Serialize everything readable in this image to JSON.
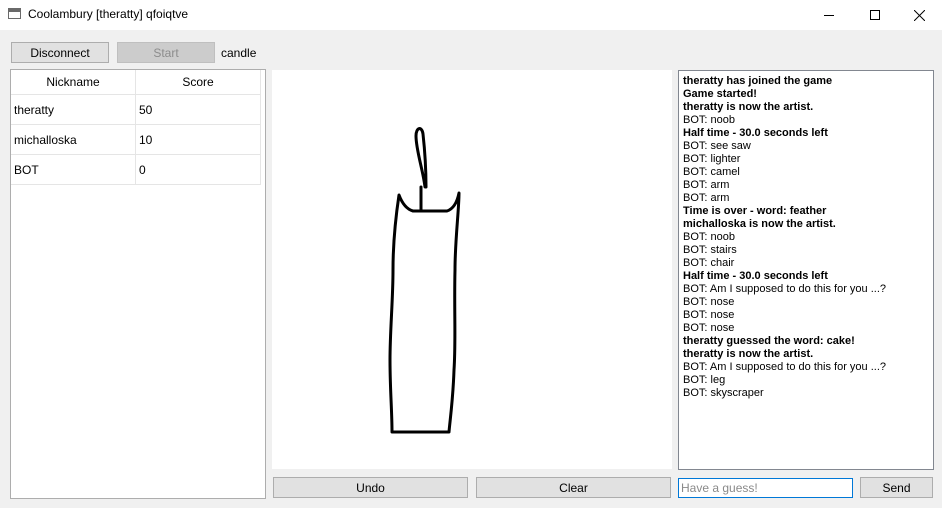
{
  "window": {
    "title": "Coolambury [theratty] qfoiqtve",
    "controls": {
      "minimize": "minimize-icon",
      "maximize": "maximize-icon",
      "close": "close-icon"
    }
  },
  "toolbar": {
    "disconnect_label": "Disconnect",
    "start_label": "Start",
    "word": "candle"
  },
  "players": {
    "headers": [
      "Nickname",
      "Score"
    ],
    "rows": [
      {
        "nickname": "theratty",
        "score": "50"
      },
      {
        "nickname": "michalloska",
        "score": "10"
      },
      {
        "nickname": "BOT",
        "score": "0"
      }
    ]
  },
  "canvas": {
    "drawing": "candle sketch",
    "stroke_color": "#000000"
  },
  "chat": {
    "messages": [
      {
        "text": "theratty has joined the game",
        "bold": true
      },
      {
        "text": "Game started!",
        "bold": true
      },
      {
        "text": "theratty is now the artist.",
        "bold": true
      },
      {
        "text": "BOT: noob",
        "bold": false
      },
      {
        "text": "Half time - 30.0 seconds left",
        "bold": true
      },
      {
        "text": "BOT: see saw",
        "bold": false
      },
      {
        "text": "BOT: lighter",
        "bold": false
      },
      {
        "text": "BOT: camel",
        "bold": false
      },
      {
        "text": "BOT: arm",
        "bold": false
      },
      {
        "text": "BOT: arm",
        "bold": false
      },
      {
        "text": "Time is over - word: feather",
        "bold": true
      },
      {
        "text": "michalloska is now the artist.",
        "bold": true
      },
      {
        "text": "BOT: noob",
        "bold": false
      },
      {
        "text": "BOT: stairs",
        "bold": false
      },
      {
        "text": "BOT: chair",
        "bold": false
      },
      {
        "text": "Half time - 30.0 seconds left",
        "bold": true
      },
      {
        "text": "BOT: Am I supposed to do this for you ...?",
        "bold": false
      },
      {
        "text": "BOT: nose",
        "bold": false
      },
      {
        "text": "BOT: nose",
        "bold": false
      },
      {
        "text": "BOT: nose",
        "bold": false
      },
      {
        "text": "theratty guessed the word: cake!",
        "bold": true
      },
      {
        "text": "theratty is now the artist.",
        "bold": true
      },
      {
        "text": "BOT: Am I supposed to do this for you ...?",
        "bold": false
      },
      {
        "text": "BOT: leg",
        "bold": false
      },
      {
        "text": "BOT: skyscraper",
        "bold": false
      }
    ]
  },
  "bottom": {
    "undo_label": "Undo",
    "clear_label": "Clear",
    "guess_value": "",
    "guess_placeholder": "Have a guess!",
    "send_label": "Send"
  }
}
